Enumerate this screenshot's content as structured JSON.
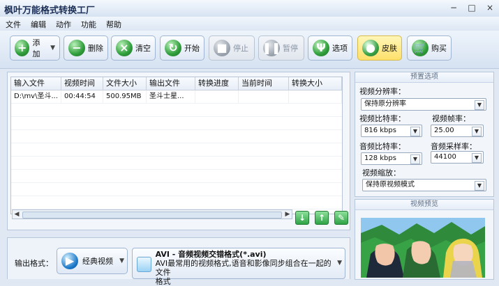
{
  "window": {
    "title": "枫叶万能格式转换工厂"
  },
  "menu": [
    "文件",
    "编辑",
    "动作",
    "功能",
    "帮助"
  ],
  "toolbar": {
    "add": "添加",
    "delete": "删除",
    "clear": "清空",
    "start": "开始",
    "stop": "停止",
    "pause": "暂停",
    "options": "选项",
    "skin": "皮肤",
    "buy": "购买"
  },
  "table": {
    "headers": [
      "输入文件",
      "视频时间",
      "文件大小",
      "输出文件",
      "转换进度",
      "当前时间",
      "转换大小"
    ],
    "rows": [
      [
        "D:\\mv\\圣斗...",
        "00:44:54",
        "500.95MB",
        "圣斗士星...",
        "",
        "",
        ""
      ]
    ]
  },
  "preset": {
    "title": "预置选项",
    "resolution_label": "视频分辨率：",
    "resolution_value": "保持原分辨率",
    "vbitrate_label": "视频比特率：",
    "vbitrate_value": "816 kbps",
    "fps_label": "视频帧率：",
    "fps_value": "25.00",
    "abitrate_label": "音频比特率：",
    "abitrate_value": "128 kbps",
    "samplerate_label": "音频采样率：",
    "samplerate_value": "44100",
    "scale_label": "视频缩放：",
    "scale_value": "保持原视频模式"
  },
  "preview": {
    "title": "视频预览"
  },
  "output": {
    "label": "输出格式：",
    "category": "经典视频",
    "format_title": "AVI - 音频视频交错格式(*.avi)",
    "format_desc_1": "AVI最常用的视频格式,语音和影像同步组合在一起的文件",
    "format_desc_2": "格式"
  },
  "colors": {
    "accent": "#2f9e3b",
    "panel": "#f2f6fb",
    "border": "#b6c7dc"
  }
}
